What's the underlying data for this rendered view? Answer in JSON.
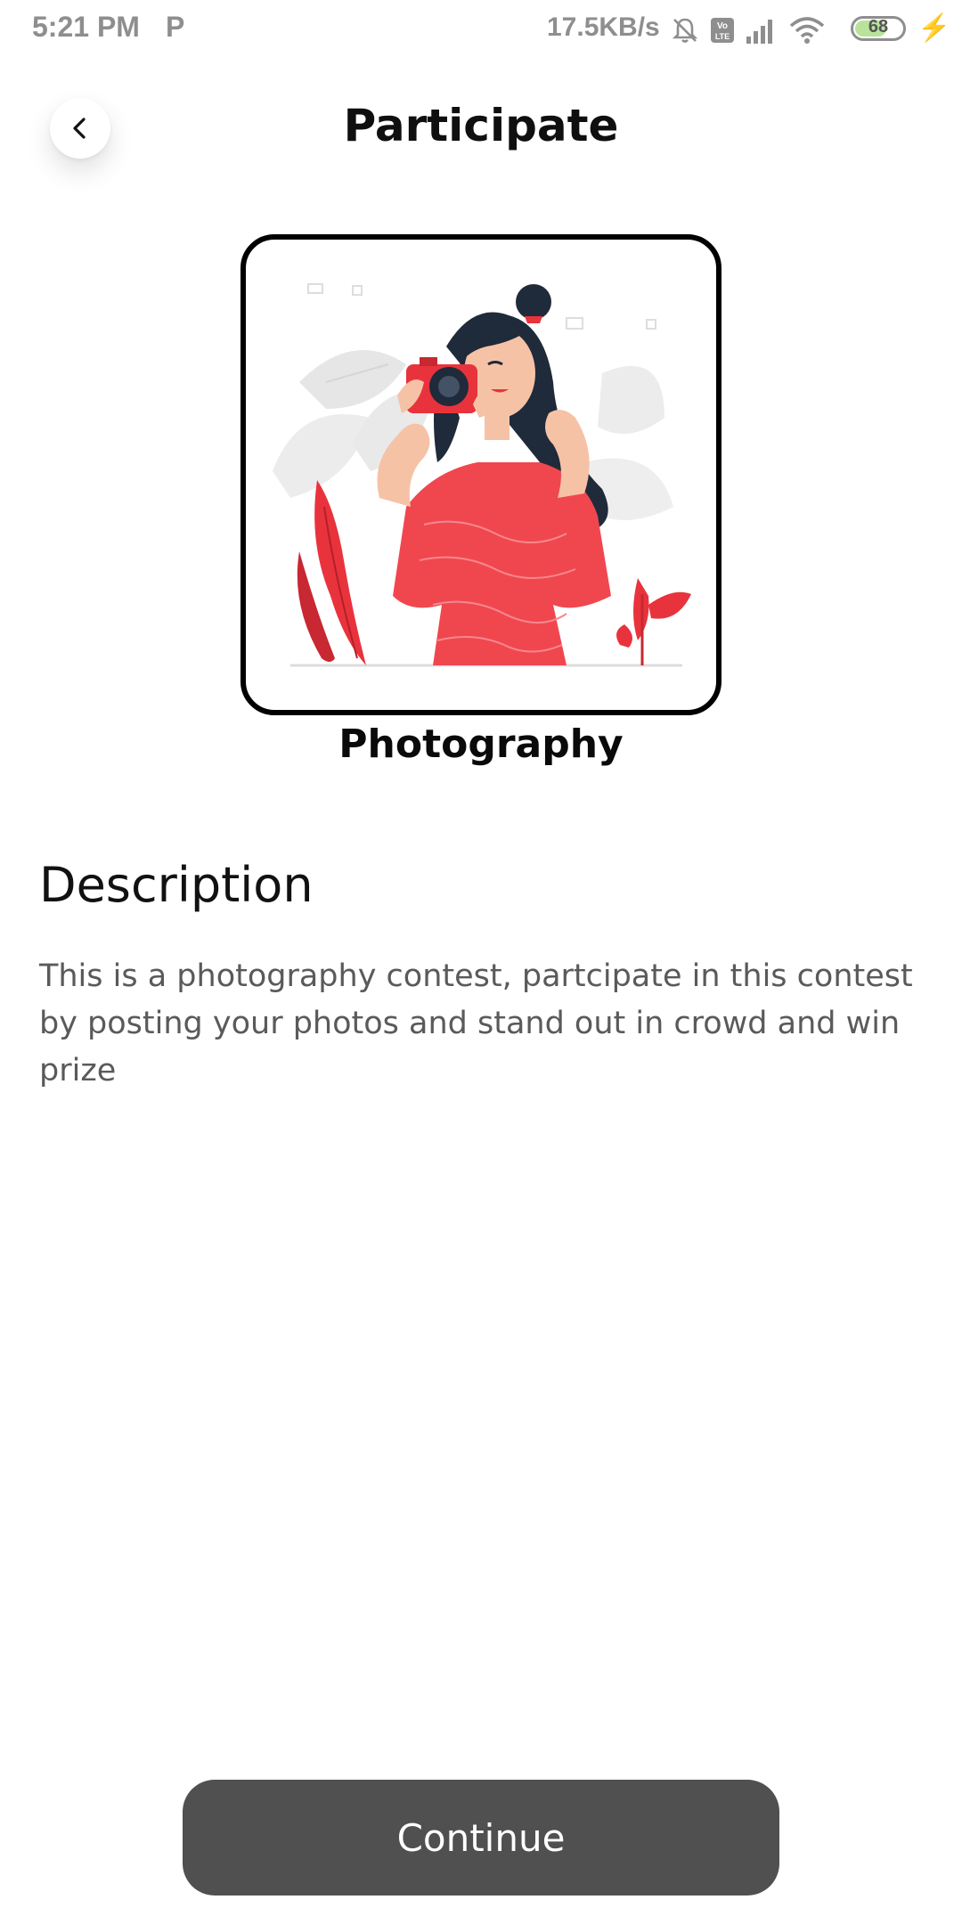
{
  "status_bar": {
    "time": "5:21 PM",
    "app_indicator": "P",
    "network_speed": "17.5KB/s",
    "battery_level": "68",
    "battery_fraction": 0.68,
    "icons": [
      "mute-bell-icon",
      "volte-icon",
      "signal-icon",
      "wifi-icon",
      "battery-icon",
      "charging-icon"
    ]
  },
  "header": {
    "title": "Participate",
    "back_icon": "chevron-left-icon"
  },
  "contest": {
    "image_alt": "woman-with-camera-illustration",
    "category": "Photography"
  },
  "description": {
    "heading": "Description",
    "body": "This is a photography contest, partcipate in this contest by posting your photos and stand out in crowd and win prize"
  },
  "actions": {
    "continue_label": "Continue"
  },
  "colors": {
    "accent_red": "#f0474f",
    "button_bg": "#505050",
    "text_primary": "#111111",
    "text_secondary": "#5a5a5a"
  }
}
